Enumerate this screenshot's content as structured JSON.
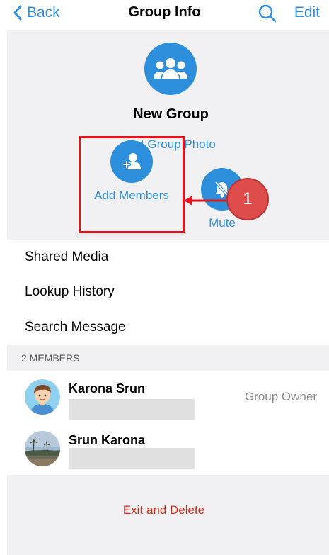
{
  "nav": {
    "back_label": "Back",
    "title": "Group Info",
    "search_icon": "search-icon",
    "edit_label": "Edit"
  },
  "group": {
    "avatar_icon": "group-people-icon",
    "name": "New Group",
    "set_photo_label": "Set Group Photo"
  },
  "actions": {
    "add_members": {
      "icon": "add-person-icon",
      "label": "Add Members"
    },
    "mute": {
      "icon": "bell-off-icon",
      "label": "Mute"
    }
  },
  "annotation": {
    "number": "1"
  },
  "menu": [
    {
      "label": "Shared Media"
    },
    {
      "label": "Lookup History"
    },
    {
      "label": "Search Message"
    }
  ],
  "members_header": "2 MEMBERS",
  "members": [
    {
      "name": "Karona Srun",
      "role": "Group Owner"
    },
    {
      "name": "Srun Karona",
      "role": ""
    }
  ],
  "footer": {
    "exit_label": "Exit and Delete"
  },
  "colors": {
    "accent": "#2d8fdc",
    "danger": "#e0260f",
    "highlight": "#e8131a",
    "background_gray": "#f1f1f4"
  }
}
